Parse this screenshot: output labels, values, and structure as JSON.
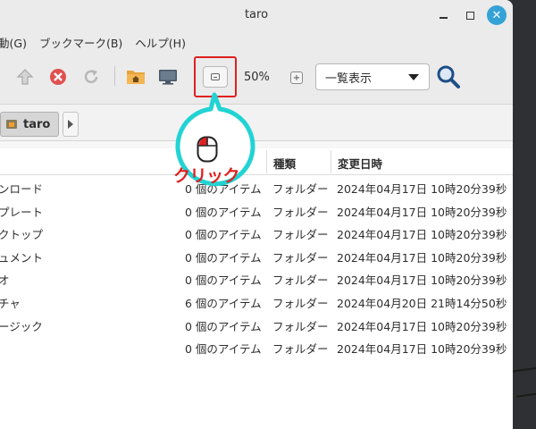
{
  "window": {
    "title": "taro"
  },
  "menubar": [
    "動(G)",
    "ブックマーク(B)",
    "ヘルプ(H)"
  ],
  "toolbar": {
    "zoom_level": "50%",
    "view_mode": "一覧表示"
  },
  "location": {
    "crumb": "taro"
  },
  "columns": {
    "type": "種類",
    "modified": "変更日時"
  },
  "rows": [
    {
      "name": "ンロード",
      "size": "0 個のアイテム",
      "type": "フォルダー",
      "date": "2024年04月17日 10時20分39秒"
    },
    {
      "name": "プレート",
      "size": "0 個のアイテム",
      "type": "フォルダー",
      "date": "2024年04月17日 10時20分39秒"
    },
    {
      "name": "クトップ",
      "size": "0 個のアイテム",
      "type": "フォルダー",
      "date": "2024年04月17日 10時20分39秒"
    },
    {
      "name": "ュメント",
      "size": "0 個のアイテム",
      "type": "フォルダー",
      "date": "2024年04月17日 10時20分39秒"
    },
    {
      "name": "オ",
      "size": "0 個のアイテム",
      "type": "フォルダー",
      "date": "2024年04月17日 10時20分39秒"
    },
    {
      "name": "チャ",
      "size": "6 個のアイテム",
      "type": "フォルダー",
      "date": "2024年04月20日 21時14分50秒"
    },
    {
      "name": "ージック",
      "size": "0 個のアイテム",
      "type": "フォルダー",
      "date": "2024年04月17日 10時20分39秒"
    },
    {
      "name": "",
      "size": "0 個のアイテム",
      "type": "フォルダー",
      "date": "2024年04月17日 10時20分39秒"
    }
  ],
  "annotation": {
    "text": "クリック"
  },
  "colors": {
    "accent": "#35a2d6",
    "callout": "#22d3d3",
    "highlight": "#e02020"
  }
}
